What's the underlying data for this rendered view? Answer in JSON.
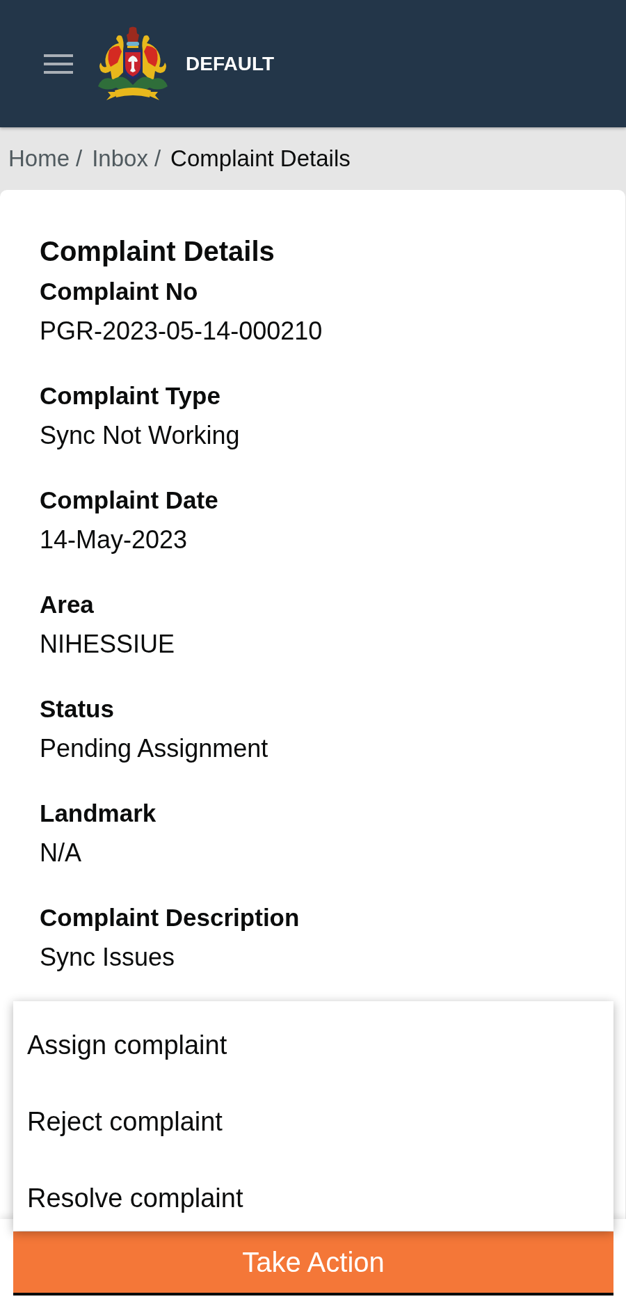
{
  "header": {
    "title": "DEFAULT"
  },
  "breadcrumb": [
    {
      "label": "Home",
      "separator": "/",
      "current": false
    },
    {
      "label": "Inbox",
      "separator": "/",
      "current": false
    },
    {
      "label": "Complaint Details",
      "current": true
    }
  ],
  "details": {
    "title": "Complaint Details",
    "fields": [
      {
        "label": "Complaint No",
        "value": "PGR-2023-05-14-000210"
      },
      {
        "label": "Complaint Type",
        "value": "Sync Not Working"
      },
      {
        "label": "Complaint Date",
        "value": "14-May-2023"
      },
      {
        "label": "Area",
        "value": "NIHESSIUE"
      },
      {
        "label": "Status",
        "value": "Pending Assignment"
      },
      {
        "label": "Landmark",
        "value": "N/A"
      },
      {
        "label": "Complaint Description",
        "value": "Sync Issues"
      }
    ]
  },
  "action_menu": {
    "items": [
      {
        "label": "Assign complaint"
      },
      {
        "label": "Reject complaint"
      },
      {
        "label": "Resolve complaint"
      }
    ]
  },
  "action_button": {
    "label": "Take Action"
  }
}
